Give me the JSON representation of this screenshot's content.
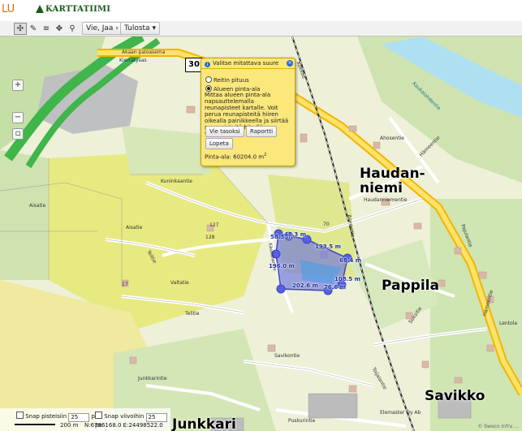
{
  "header": {
    "brand_left": "LU",
    "brand_name": "KARTTATIIMI"
  },
  "toolbar": {
    "share_menu": "Vie, Jaa",
    "print_menu": "Tulosta",
    "icons": [
      "pan-icon",
      "pencil-icon",
      "list-icon",
      "crosshair-icon",
      "measure-icon"
    ]
  },
  "measure_panel": {
    "title": "Valitse mitattava suure",
    "option_route": "Reitin pituus",
    "option_area": "Alueen pinta-ala",
    "description": "Mittaa alueen pinta-ala napsauttelemalla reunapisteet kartalle. Voit perua reunapisteitä hiiren oikealla painikkeella ja siirtää reunapisteitä hiirellä vetämällä.",
    "btn_export": "Vie tasoksi",
    "btn_report": "Raportti",
    "btn_stop": "Lopeta",
    "result_label": "Pinta-ala: 60204.0 m",
    "result_sup": "2"
  },
  "measurements": {
    "m1": "58.3 m",
    "m2": "48.3 m",
    "m3": "193.5 m",
    "m4": "68.4 m",
    "m5": "196.0 m",
    "m6": "108.5 m",
    "m7": "202.6 m",
    "m8": "76.6 m"
  },
  "places": {
    "haudanniemi": "Haudan-\nniemi",
    "pappila": "Pappila",
    "savikko": "Savikko",
    "junkkari": "Junkkari"
  },
  "streets": {
    "akaan": "Akaan paloasema",
    "kierratyssa": "Kierrätysas",
    "valtatie": "Valtatie",
    "rautatie": "Asematie",
    "aisatie": "Aisatie",
    "aisatie2": "Aisatie",
    "kuninkaantie": "Kuninkaantie",
    "haudanniementie": "Haudanniementie",
    "hameentie": "Hämeentie",
    "hameentie2": "Hämeentie",
    "ahosentie": "Ahosentie",
    "telitie": "Telitie",
    "telitie2": "Telitie",
    "kaukolantie": "Kaukolantie",
    "savikontie": "Savikontie",
    "junkkarintie": "Junkkarintie",
    "tojalantie": "Toijalantie",
    "pajulantie": "Pajulantie",
    "lentola": "Lentola",
    "suksitie": "Suksitie",
    "puskurintie": "Puskurintie",
    "elemaster": "Elemaster Oy Ab",
    "kaukolahdentie": "Kaukolahdentie",
    "kotkant": "Kokkoo"
  },
  "house_numbers": [
    "127",
    "128",
    "70",
    "72",
    "71",
    "76",
    "76",
    "18",
    "17",
    "15"
  ],
  "road_sign": "30",
  "bottom": {
    "snap_points_label": "Snap pisteisiin",
    "snap_points_value": "25",
    "snap_points_unit": "px",
    "snap_lines_label": "Snap viivoihin",
    "snap_lines_value": "25",
    "snap_lines_unit": "px",
    "scale_label": "200 m",
    "coords": "N:6786168.0 E:24498522.0"
  },
  "copyright": "© Sweco Infra ..."
}
